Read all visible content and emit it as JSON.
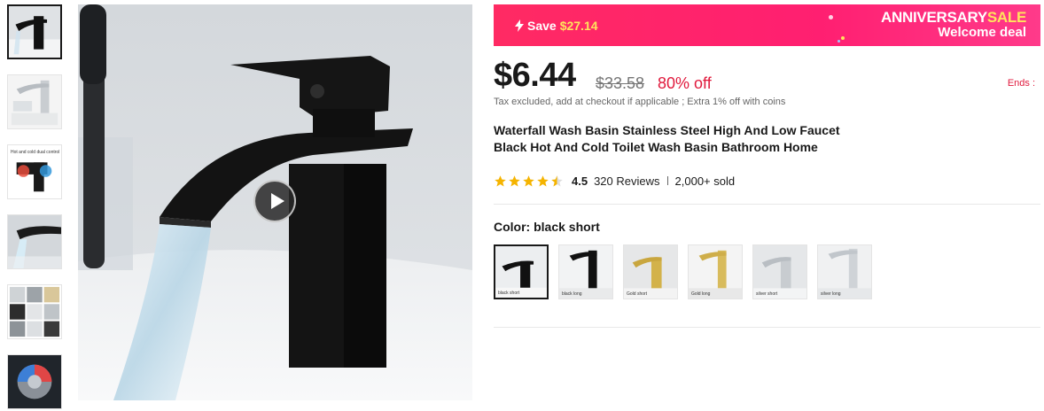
{
  "gallery": {
    "thumbnails": [
      {
        "name": "black faucet",
        "icon": "faucet-black-thumb"
      },
      {
        "name": "chrome faucet",
        "icon": "faucet-chrome-thumb"
      },
      {
        "name": "hot and cold control",
        "label": "Hot and cold dual control",
        "icon": "hot-cold-thumb"
      },
      {
        "name": "waterfall closeup",
        "icon": "waterfall-thumb"
      },
      {
        "name": "variant grid",
        "icon": "grid-thumb"
      },
      {
        "name": "valve detail",
        "icon": "valve-thumb"
      }
    ],
    "main_video_icon": "play-icon"
  },
  "banner": {
    "save_prefix": "Save",
    "save_amount": "$27.14",
    "anniversary": "ANNIVERSARY",
    "sale": "SALE",
    "welcome": "Welcome deal",
    "colors": {
      "bg": "#ff1f71",
      "accent": "#ffe45c"
    }
  },
  "pricing": {
    "price": "$6.44",
    "original": "$33.58",
    "discount": "80% off",
    "ends": "Ends :",
    "tax_note": "Tax excluded, add at checkout if applicable ; Extra 1% off with coins"
  },
  "product": {
    "title": "Waterfall Wash Basin Stainless Steel High And Low Faucet Black Hot And Cold Toilet Wash Basin Bathroom Home",
    "rating": "4.5",
    "stars_value": 4.5,
    "reviews": "320 Reviews",
    "sold": "2,000+ sold"
  },
  "variants": {
    "label": "Color: black short",
    "options": [
      {
        "caption": "black short",
        "selected": true
      },
      {
        "caption": "black long",
        "selected": false
      },
      {
        "caption": "Gold short",
        "selected": false
      },
      {
        "caption": "Gold long",
        "selected": false
      },
      {
        "caption": "silver short",
        "selected": false
      },
      {
        "caption": "silver long",
        "selected": false
      }
    ]
  }
}
